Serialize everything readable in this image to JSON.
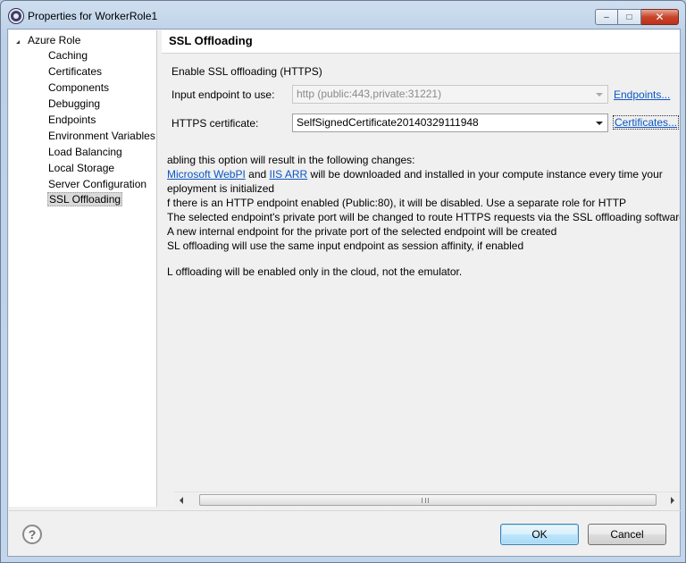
{
  "window": {
    "title": "Properties for WorkerRole1",
    "buttons": {
      "minimize": "–",
      "maximize": "□",
      "close": "✕"
    }
  },
  "tree": {
    "root": "Azure Role",
    "items": [
      "Caching",
      "Certificates",
      "Components",
      "Debugging",
      "Endpoints",
      "Environment Variables",
      "Load Balancing",
      "Local Storage",
      "Server Configuration",
      "SSL Offloading"
    ],
    "selected": "SSL Offloading"
  },
  "panel": {
    "title": "SSL Offloading",
    "enable_label": "Enable SSL offloading (HTTPS)",
    "endpoint_label": "Input endpoint to use:",
    "endpoint_value": "http (public:443,private:31221)",
    "endpoints_link": "Endpoints...",
    "cert_label": "HTTPS certificate:",
    "cert_value": "SelfSignedCertificate20140329111948",
    "certificates_link": "Certificates...",
    "desc": {
      "intro": "abling this option will result in the following changes:",
      "line1_link1": "Microsoft WebPI",
      "line1_and": " and ",
      "line1_link2": "IIS ARR",
      "line1_rest": " will be downloaded and installed in your compute instance every time your",
      "line2": "eployment is initialized",
      "line3": "f there is an HTTP endpoint enabled (Public:80), it will be disabled. Use a separate role for HTTP",
      "line4": "The selected endpoint's private port will be changed to route HTTPS requests via the SSL offloading software",
      "line5": "A new internal endpoint for the private port of the selected endpoint will be created",
      "line6": "SL offloading will use the same input endpoint as session affinity, if enabled",
      "note": "L offloading will be enabled only in the cloud, not the emulator."
    }
  },
  "footer": {
    "help_symbol": "?",
    "ok": "OK",
    "cancel": "Cancel"
  },
  "icons": [
    "app-icon",
    "help-icon",
    "tree-collapse-icon",
    "dropdown-arrow-icon",
    "scroll-left-icon",
    "scroll-right-icon"
  ]
}
